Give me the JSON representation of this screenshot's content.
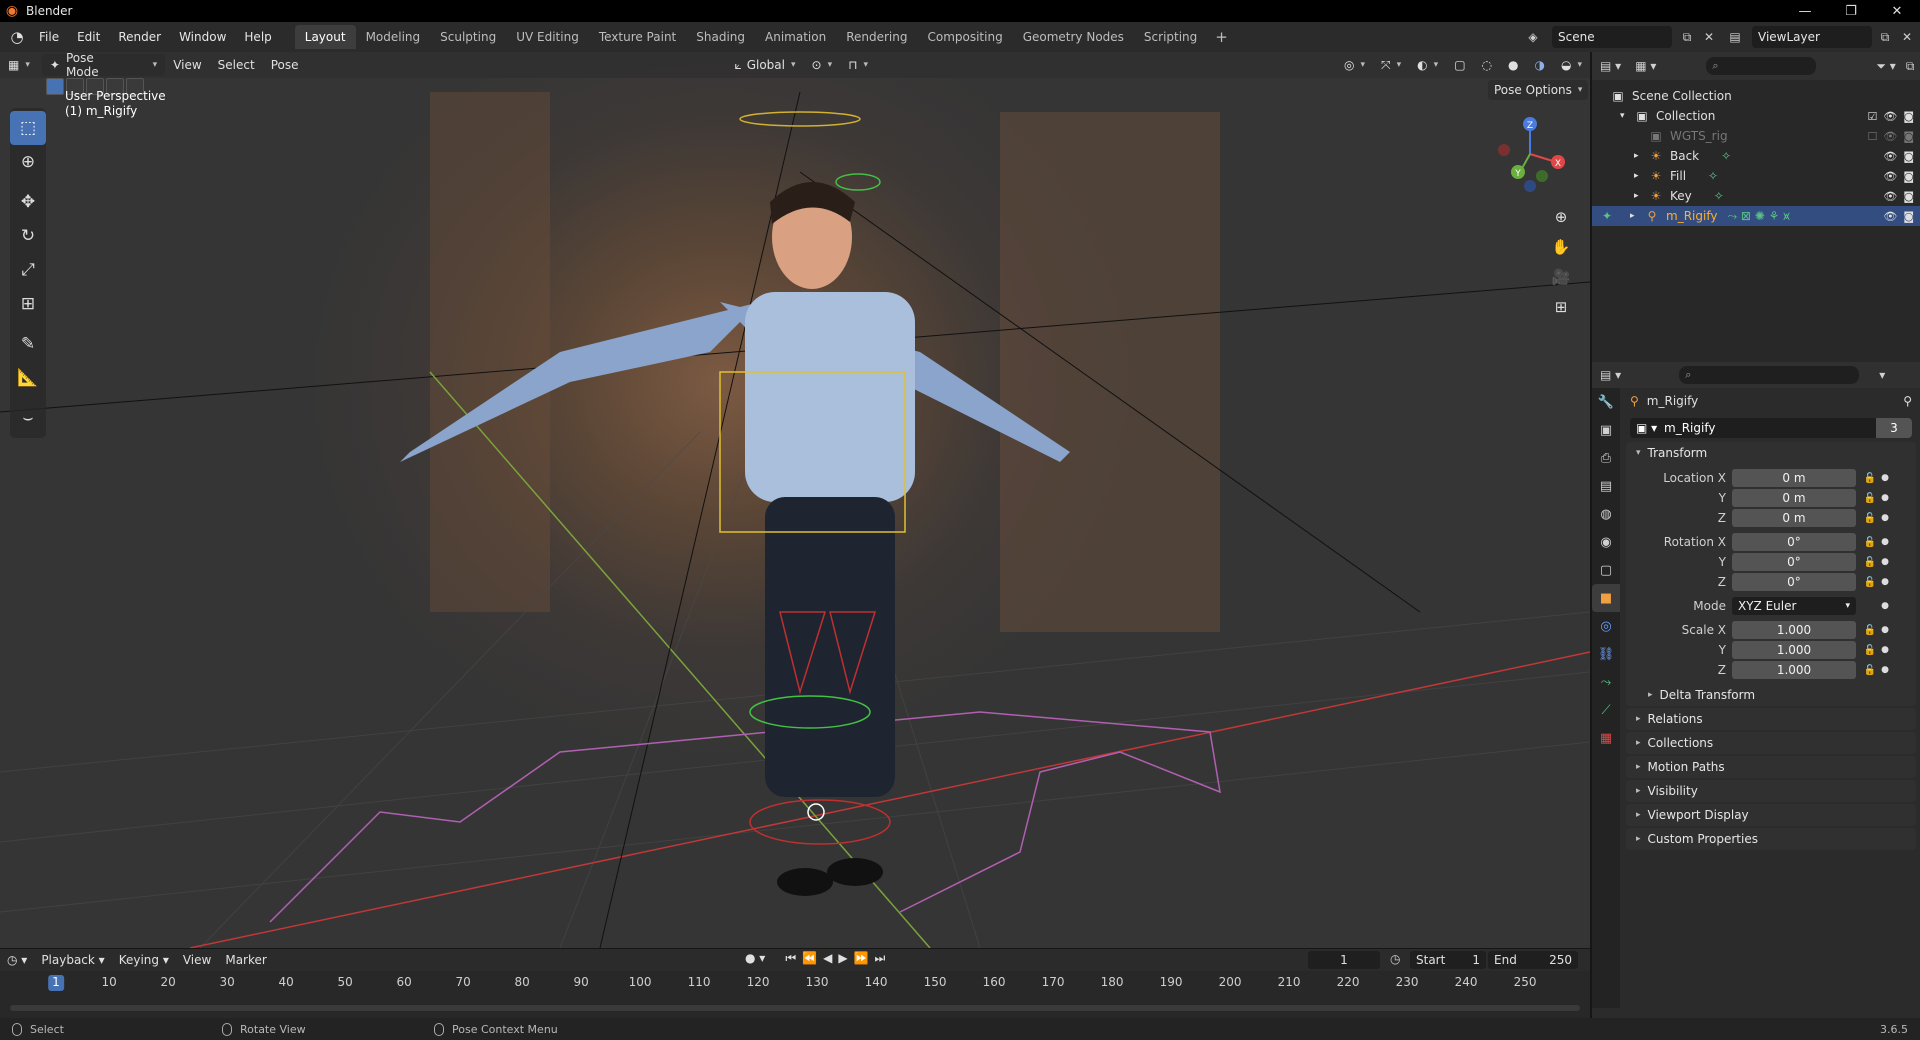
{
  "window": {
    "title": "Blender",
    "controls": [
      "—",
      "❐",
      "✕"
    ]
  },
  "menu": [
    "File",
    "Edit",
    "Render",
    "Window",
    "Help"
  ],
  "workspaces": [
    "Layout",
    "Modeling",
    "Sculpting",
    "UV Editing",
    "Texture Paint",
    "Shading",
    "Animation",
    "Rendering",
    "Compositing",
    "Geometry Nodes",
    "Scripting"
  ],
  "active_workspace": "Layout",
  "scene": "Scene",
  "view_layer": "ViewLayer",
  "viewport": {
    "mode": "Pose Mode",
    "menus": [
      "View",
      "Select",
      "Pose"
    ],
    "transform_orientation": "Global",
    "overlay_title": "User Perspective",
    "overlay_object": "(1) m_Rigify",
    "pose_options": "Pose Options",
    "gizmo_axes": [
      "X",
      "Y",
      "Z"
    ]
  },
  "outliner": {
    "search_placeholder": "",
    "root": "Scene Collection",
    "collection": "Collection",
    "items": [
      {
        "name": "WGTS_rig",
        "dim": true
      },
      {
        "name": "Back",
        "dim": false
      },
      {
        "name": "Fill",
        "dim": false
      },
      {
        "name": "Key",
        "dim": false
      },
      {
        "name": "m_Rigify",
        "dim": false,
        "selected": true
      }
    ]
  },
  "properties": {
    "object_name": "m_Rigify",
    "data_name": "m_Rigify",
    "users": "3",
    "transform_label": "Transform",
    "location": {
      "label": "Location X",
      "x": "0 m",
      "y": "0 m",
      "z": "0 m"
    },
    "rotation": {
      "label": "Rotation X",
      "x": "0°",
      "y": "0°",
      "z": "0°"
    },
    "mode_label": "Mode",
    "mode_value": "XYZ Euler",
    "scale": {
      "label": "Scale X",
      "x": "1.000",
      "y": "1.000",
      "z": "1.000"
    },
    "axis_y": "Y",
    "axis_z": "Z",
    "panels": [
      "Delta Transform",
      "Relations",
      "Collections",
      "Motion Paths",
      "Visibility",
      "Viewport Display",
      "Custom Properties"
    ]
  },
  "timeline": {
    "menus": [
      "Playback",
      "Keying",
      "View",
      "Marker"
    ],
    "current_frame": "1",
    "start_label": "Start",
    "start": "1",
    "end_label": "End",
    "end": "250",
    "ruler": [
      10,
      20,
      30,
      40,
      50,
      60,
      70,
      80,
      90,
      100,
      110,
      120,
      130,
      140,
      150,
      160,
      170,
      180,
      190,
      200,
      210,
      220,
      230,
      240,
      250
    ]
  },
  "statusbar": {
    "select": "Select",
    "rotate": "Rotate View",
    "context": "Pose Context Menu",
    "version": "3.6.5"
  },
  "colors": {
    "accent": "#4772b3",
    "brand": "#f5792a"
  }
}
